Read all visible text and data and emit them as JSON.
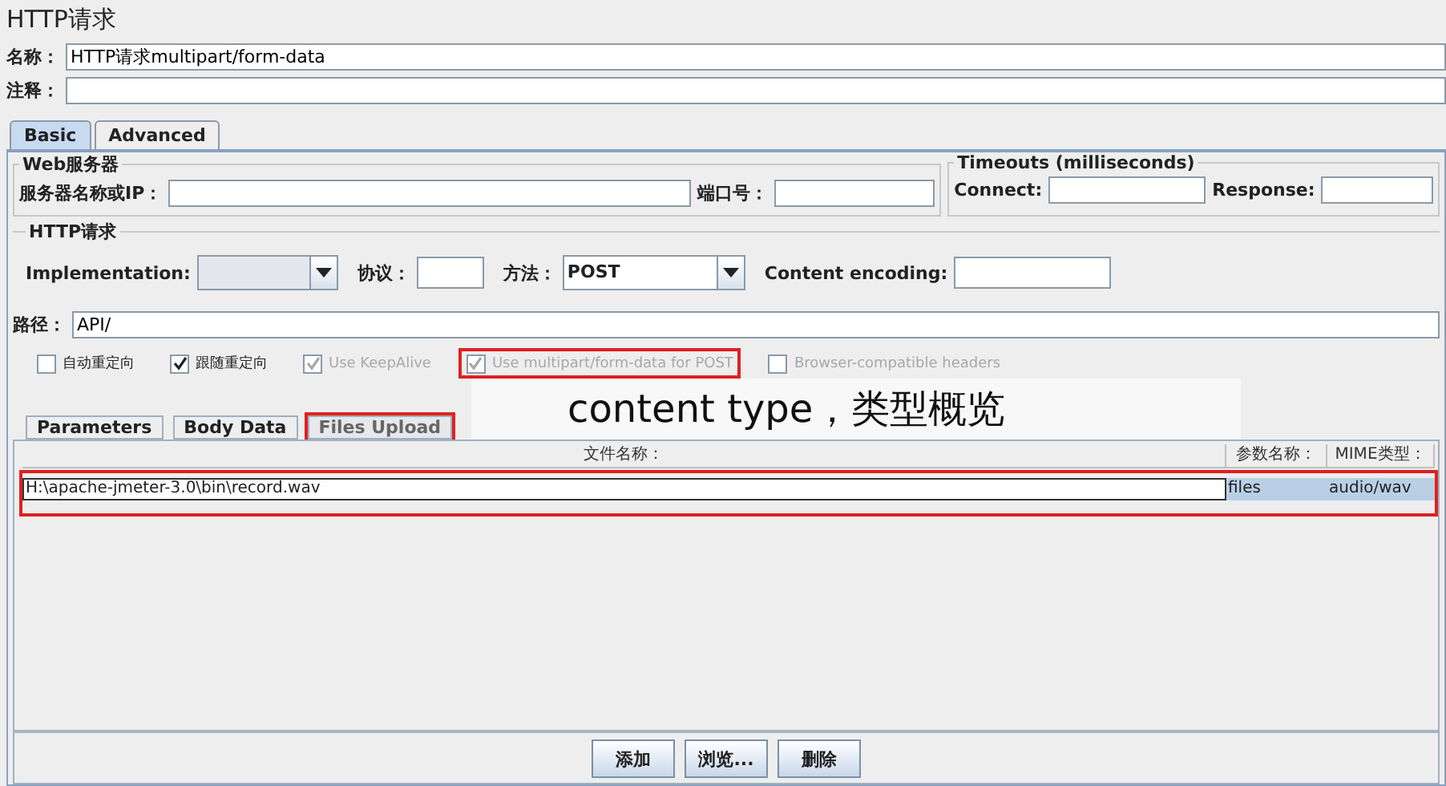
{
  "window": {
    "title": "HTTP请求"
  },
  "name_field": {
    "label": "名称：",
    "value": "HTTP请求multipart/form-data"
  },
  "comment_field": {
    "label": "注释："
  },
  "tabs": [
    {
      "label": "Basic",
      "selected": true
    },
    {
      "label": "Advanced",
      "selected": false
    }
  ],
  "web_server": {
    "title": "Web服务器",
    "host_label": "服务器名称或IP：",
    "port_label": "端口号："
  },
  "timeouts": {
    "title": "Timeouts (milliseconds)",
    "connect_label": "Connect:",
    "response_label": "Response:"
  },
  "http_request": {
    "title": "HTTP请求",
    "implementation_label": "Implementation:",
    "protocol_label": "协议：",
    "method_label": "方法：",
    "method_value": "POST",
    "encoding_label": "Content encoding:",
    "path_label": "路径：",
    "path_value": "API/"
  },
  "options": [
    {
      "label": "自动重定向",
      "checked": false,
      "disabled": false,
      "highlighted": false
    },
    {
      "label": "跟随重定向",
      "checked": true,
      "disabled": false,
      "highlighted": false
    },
    {
      "label": "Use KeepAlive",
      "checked": true,
      "disabled": true,
      "highlighted": false
    },
    {
      "label": "Use multipart/form-data for POST",
      "checked": true,
      "disabled": true,
      "highlighted": true
    },
    {
      "label": "Browser-compatible headers",
      "checked": false,
      "disabled": true,
      "highlighted": false
    }
  ],
  "sub_tabs": [
    {
      "label": "Parameters",
      "selected": false,
      "highlighted": false
    },
    {
      "label": "Body Data",
      "selected": false,
      "highlighted": false
    },
    {
      "label": "Files Upload",
      "selected": true,
      "highlighted": true
    }
  ],
  "table": {
    "columns": [
      "文件名称：",
      "参数名称：",
      "MIME类型："
    ],
    "rows": [
      {
        "cells": [
          "H:\\apache-jmeter-3.0\\bin\\record.wav",
          "files",
          "audio/wav"
        ],
        "selected": true,
        "highlighted": true
      }
    ]
  },
  "buttons": [
    "添加",
    "浏览...",
    "删除"
  ],
  "annotation": "content type，类型概览"
}
